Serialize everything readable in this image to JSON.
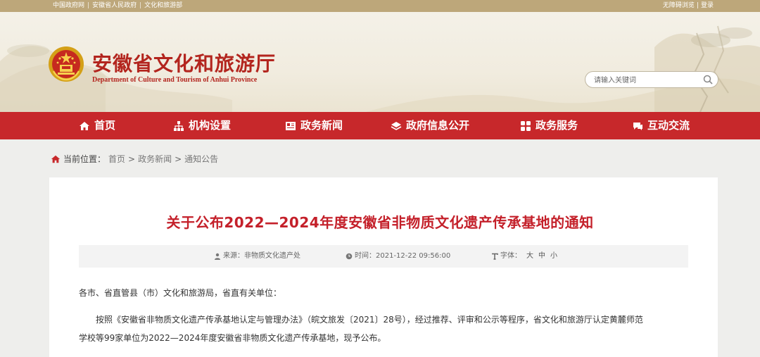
{
  "topbar": {
    "links": [
      "中国政府网",
      "安徽省人民政府",
      "文化和旅游部"
    ],
    "right_links": [
      "无障碍浏览",
      "登录"
    ]
  },
  "header": {
    "title": "安徽省文化和旅游厅",
    "subtitle": "Department of Culture and Tourism of Anhui Province",
    "search_placeholder": "请输入关键词"
  },
  "nav": {
    "items": [
      {
        "label": "首页",
        "icon": "home-icon"
      },
      {
        "label": "机构设置",
        "icon": "org-chart-icon"
      },
      {
        "label": "政务新闻",
        "icon": "news-icon"
      },
      {
        "label": "政府信息公开",
        "icon": "layers-icon"
      },
      {
        "label": "政务服务",
        "icon": "grid-icon"
      },
      {
        "label": "互动交流",
        "icon": "chat-icon"
      }
    ]
  },
  "breadcrumb": {
    "label": "当前位置：",
    "items": [
      "首页",
      "政务新闻",
      "通知公告"
    ],
    "separator": ">"
  },
  "article": {
    "title": "关于公布2022—2024年度安徽省非物质文化遗产传承基地的通知",
    "source": "来源：非物质文化遗产处",
    "time": "时间：2021-12-22 09:56:00",
    "font_label": "字体：",
    "font_sizes": [
      "大",
      "中",
      "小"
    ],
    "greeting": "各市、省直管县（市）文化和旅游局，省直有关单位：",
    "para1_line1": "按照《安徽省非物质文化遗产传承基地认定与管理办法》（皖文旅发〔2021〕28号），经过推荐、评审和公示等程序，省文化和旅游厅认定黄麓师范",
    "para1_line2": "学校等99家单位为2022—2024年度安徽省非物质文化遗产传承基地，现予公布。"
  },
  "colors": {
    "nav_red": "#c7282b",
    "title_red": "#c4202a",
    "topbar_tan": "#bda77a"
  }
}
